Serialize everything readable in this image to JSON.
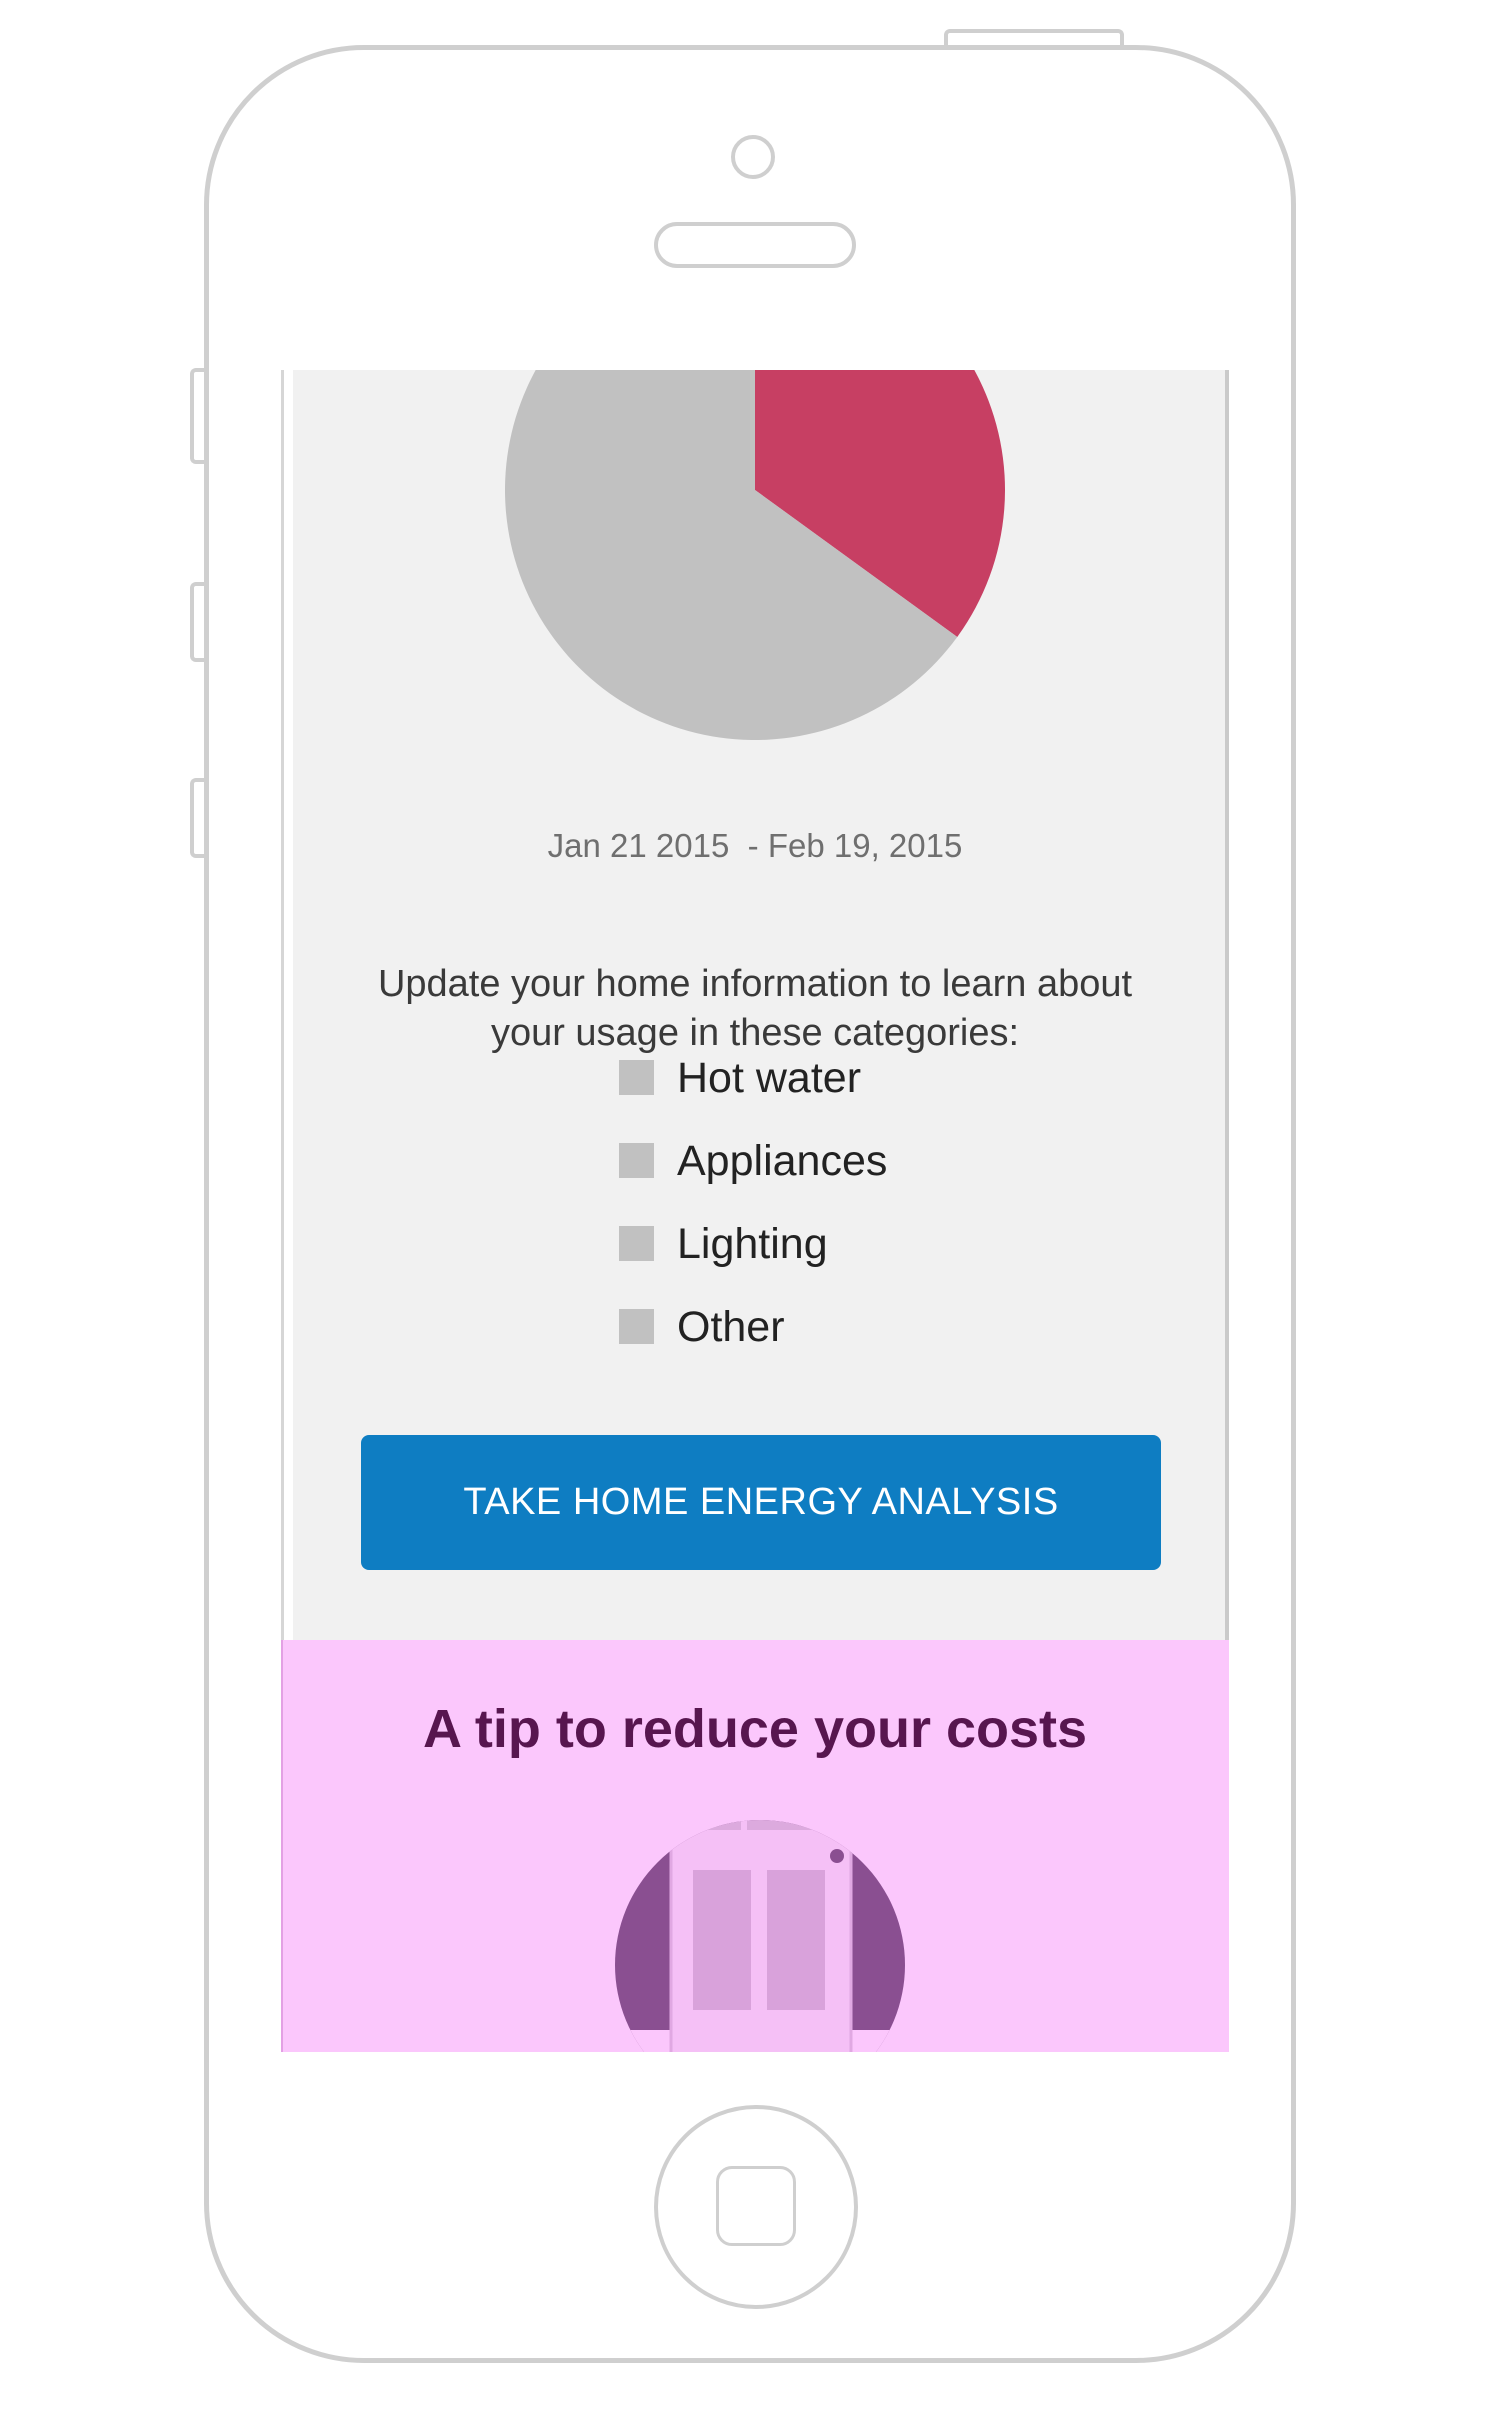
{
  "usage_breakdown": {
    "date_range": "Jan 21 2015  - Feb 19, 2015",
    "intro_text": "Update your home information to learn about your usage in these categories:",
    "categories": [
      {
        "label": "Hot water"
      },
      {
        "label": "Appliances"
      },
      {
        "label": "Lighting"
      },
      {
        "label": "Other"
      }
    ],
    "cta_label": "TAKE HOME ENERGY ANALYSIS"
  },
  "tip": {
    "title": "A tip to reduce your costs",
    "illustration_icon": "door-icon"
  },
  "colors": {
    "accent": "#0e7dc2",
    "highlight_slice": "#c73f63",
    "neutral_slice": "#c1c1c1",
    "tip_background": "#fbc7fc",
    "tip_title": "#57164f"
  },
  "chart_data": {
    "type": "pie",
    "slices": [
      {
        "value": 35,
        "color": "#c73f63"
      },
      {
        "value": 65,
        "color": "#c1c1c1"
      }
    ]
  }
}
